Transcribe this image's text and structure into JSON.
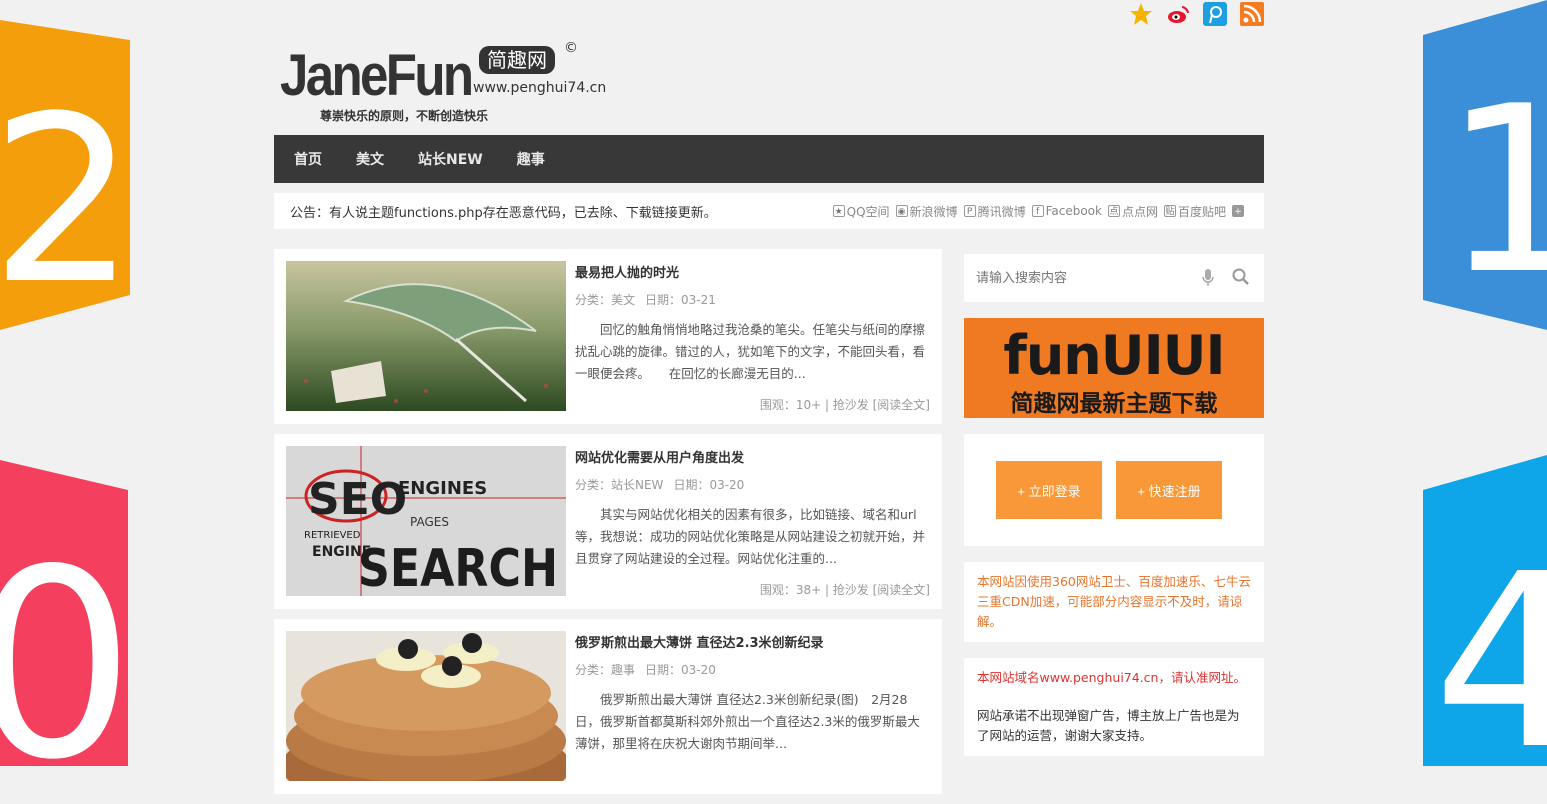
{
  "site": {
    "logo_main": "JaneFun",
    "logo_badge": "简趣网",
    "logo_copyright": "©",
    "logo_url": "www.penghui74.cn",
    "slogan": "尊崇快乐的原则，不断创造快乐"
  },
  "decor": {
    "left_top_digit": "2",
    "left_bottom_digit": "0",
    "right_top_digit": "1",
    "right_bottom_digit": "4"
  },
  "nav": [
    "首页",
    "美文",
    "站长NEW",
    "趣事"
  ],
  "notice": "公告：有人说主题functions.php存在恶意代码，已去除、下载链接更新。",
  "share": [
    {
      "label": "QQ空间",
      "icon": "qzone-icon"
    },
    {
      "label": "新浪微博",
      "icon": "weibo-icon"
    },
    {
      "label": "腾讯微博",
      "icon": "tencent-weibo-icon"
    },
    {
      "label": "Facebook",
      "icon": "facebook-icon"
    },
    {
      "label": "点点网",
      "icon": "diandian-icon"
    },
    {
      "label": "百度贴吧",
      "icon": "tieba-icon"
    }
  ],
  "articles": [
    {
      "title": "最易把人抛的时光",
      "category": "分类：美文",
      "date": "日期：03-21",
      "excerpt": "回忆的触角悄悄地略过我沧桑的笔尖。任笔尖与纸间的摩擦扰乱心跳的旋律。错过的人，犹如笔下的文字，不能回头看，看一眼便会疼。　　在回忆的长廊漫无目的...",
      "footer": "围观：10+ | 抢沙发  [阅读全文]"
    },
    {
      "title": "网站优化需要从用户角度出发",
      "category": "分类：站长NEW",
      "date": "日期：03-20",
      "excerpt": "其实与网站优化相关的因素有很多，比如链接、域名和url等，我想说：成功的网站优化策略是从网站建设之初就开始，并且贯穿了网站建设的全过程。网站优化注重的...",
      "footer": "围观：38+ | 抢沙发  [阅读全文]"
    },
    {
      "title": "俄罗斯煎出最大薄饼 直径达2.3米创新纪录",
      "category": "分类：趣事",
      "date": "日期：03-20",
      "excerpt": "俄罗斯煎出最大薄饼 直径达2.3米创新纪录(图)　2月28日，俄罗斯首都莫斯科郊外煎出一个直径达2.3米的俄罗斯最大薄饼，那里将在庆祝大谢肉节期间举...",
      "footer": ""
    }
  ],
  "thumb2_text": {
    "a": "SEO",
    "b": "ENGINES",
    "c": "PAGES",
    "d": "RETRIEVED",
    "e": "ENGINE",
    "f": "SEARCH"
  },
  "sidebar": {
    "search_placeholder": "请输入搜索内容",
    "banner_title": "funUIUI",
    "banner_sub": "简趣网最新主题下载",
    "login": "+ 立即登录",
    "register": "+ 快速注册",
    "cdn_notice": "本网站因使用360网站卫士、百度加速乐、七牛云三重CDN加速，可能部分内容显示不及时，请谅解。",
    "domain_notice": "本网站域名www.penghui74.cn，请认准网址。",
    "ad_notice": "网站承诺不出现弹窗广告，博主放上广告也是为了网站的运营，谢谢大家支持。"
  },
  "colors": {
    "orange": "#f89838",
    "nav": "#383838",
    "banner": "#f07a22",
    "red": "#dd3333"
  }
}
